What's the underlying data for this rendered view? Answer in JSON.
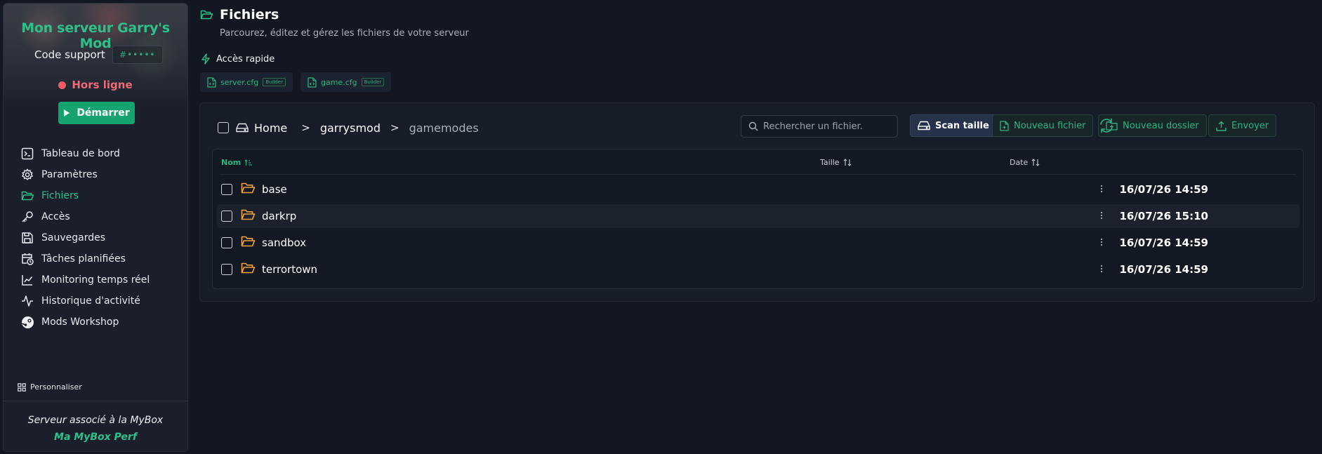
{
  "sidebar": {
    "server_name": "Mon serveur Garry's Mod",
    "support_label": "Code support",
    "support_code": "#•••••",
    "status": "Hors ligne",
    "start_label": "Démarrer",
    "nav": [
      {
        "label": "Tableau de bord",
        "icon": "terminal-icon"
      },
      {
        "label": "Paramètres",
        "icon": "gear-icon"
      },
      {
        "label": "Fichiers",
        "icon": "folder-open-icon",
        "active": true
      },
      {
        "label": "Accès",
        "icon": "key-icon"
      },
      {
        "label": "Sauvegardes",
        "icon": "save-icon"
      },
      {
        "label": "Tâches planifiées",
        "icon": "calendar-clock-icon"
      },
      {
        "label": "Monitoring temps réel",
        "icon": "line-chart-icon"
      },
      {
        "label": "Historique d'activité",
        "icon": "activity-icon"
      },
      {
        "label": "Mods Workshop",
        "icon": "steam-icon"
      }
    ],
    "personalize": "Personnaliser",
    "mybox_assoc": "Serveur associé à la MyBox",
    "mybox_name": "Ma MyBox Perf"
  },
  "header": {
    "title": "Fichiers",
    "subtitle": "Parcourez, éditez et gérez les fichiers de votre serveur",
    "quick_access": "Accès rapide",
    "quick_files": [
      {
        "name": "server.cfg",
        "badge": "Builder"
      },
      {
        "name": "game.cfg",
        "badge": "Builder"
      }
    ]
  },
  "browser": {
    "breadcrumb": {
      "home": "Home",
      "sep": ">",
      "mid": "garrysmod",
      "current": "gamemodes"
    },
    "search_placeholder": "Rechercher un fichier.",
    "scan_label": "Scan taille",
    "new_file_label": "Nouveau fichier",
    "new_folder_label": "Nouveau dossier",
    "upload_label": "Envoyer",
    "columns": {
      "name": "Nom",
      "size": "Taille",
      "date": "Date"
    },
    "rows": [
      {
        "name": "base",
        "date": "16/07/26 14:59"
      },
      {
        "name": "darkrp",
        "date": "16/07/26 15:10"
      },
      {
        "name": "sandbox",
        "date": "16/07/26 14:59"
      },
      {
        "name": "terrortown",
        "date": "16/07/26 14:59"
      }
    ]
  },
  "colors": {
    "accent": "#2fc08a",
    "start_button": "#17a36f",
    "offline": "#ee5a66",
    "folder": "#f0a13c",
    "background": "#121721"
  }
}
